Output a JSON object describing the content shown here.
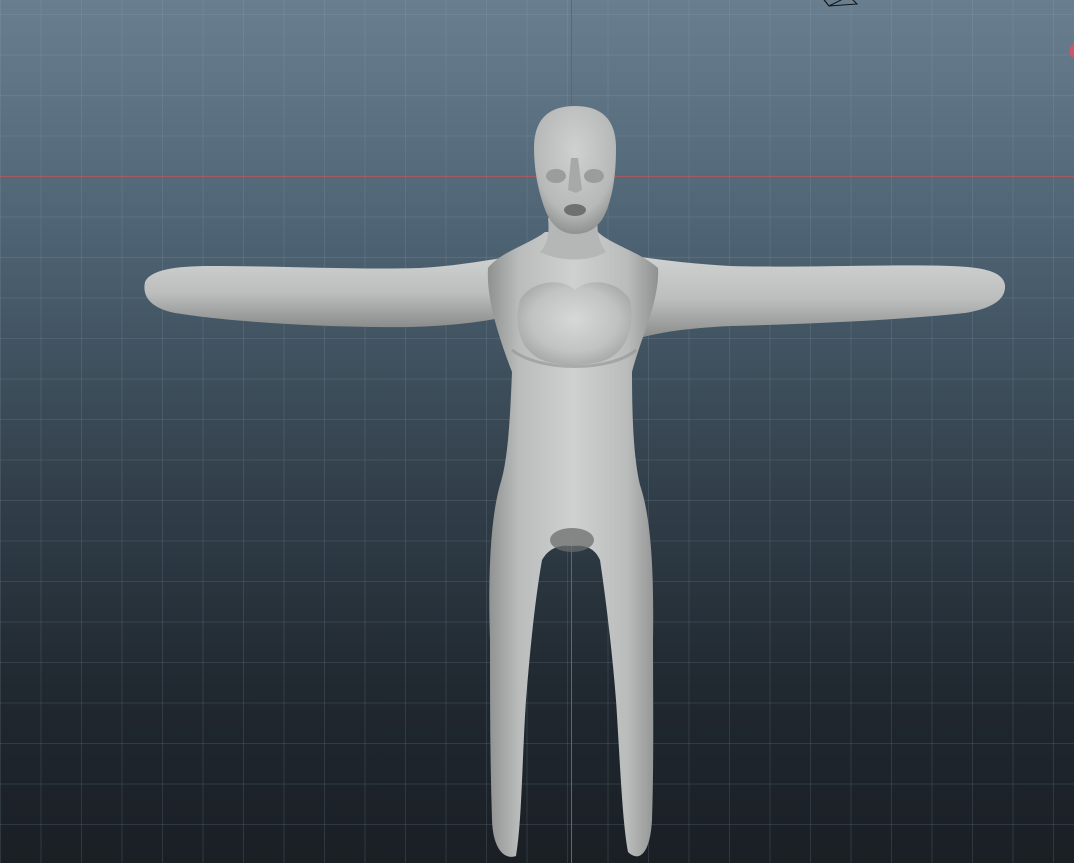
{
  "viewport": {
    "projection": "front",
    "background_top": "#697f8f",
    "background_bottom": "#1a1f24",
    "grid_color": "#96afc3",
    "x_axis_color": "#a55a62",
    "z_axis_color": "#3f6f9a",
    "model_color": "#c4c6c5"
  },
  "icons": {
    "view_cube": "view-cube-icon",
    "axis_marker": "axis-marker-icon"
  }
}
